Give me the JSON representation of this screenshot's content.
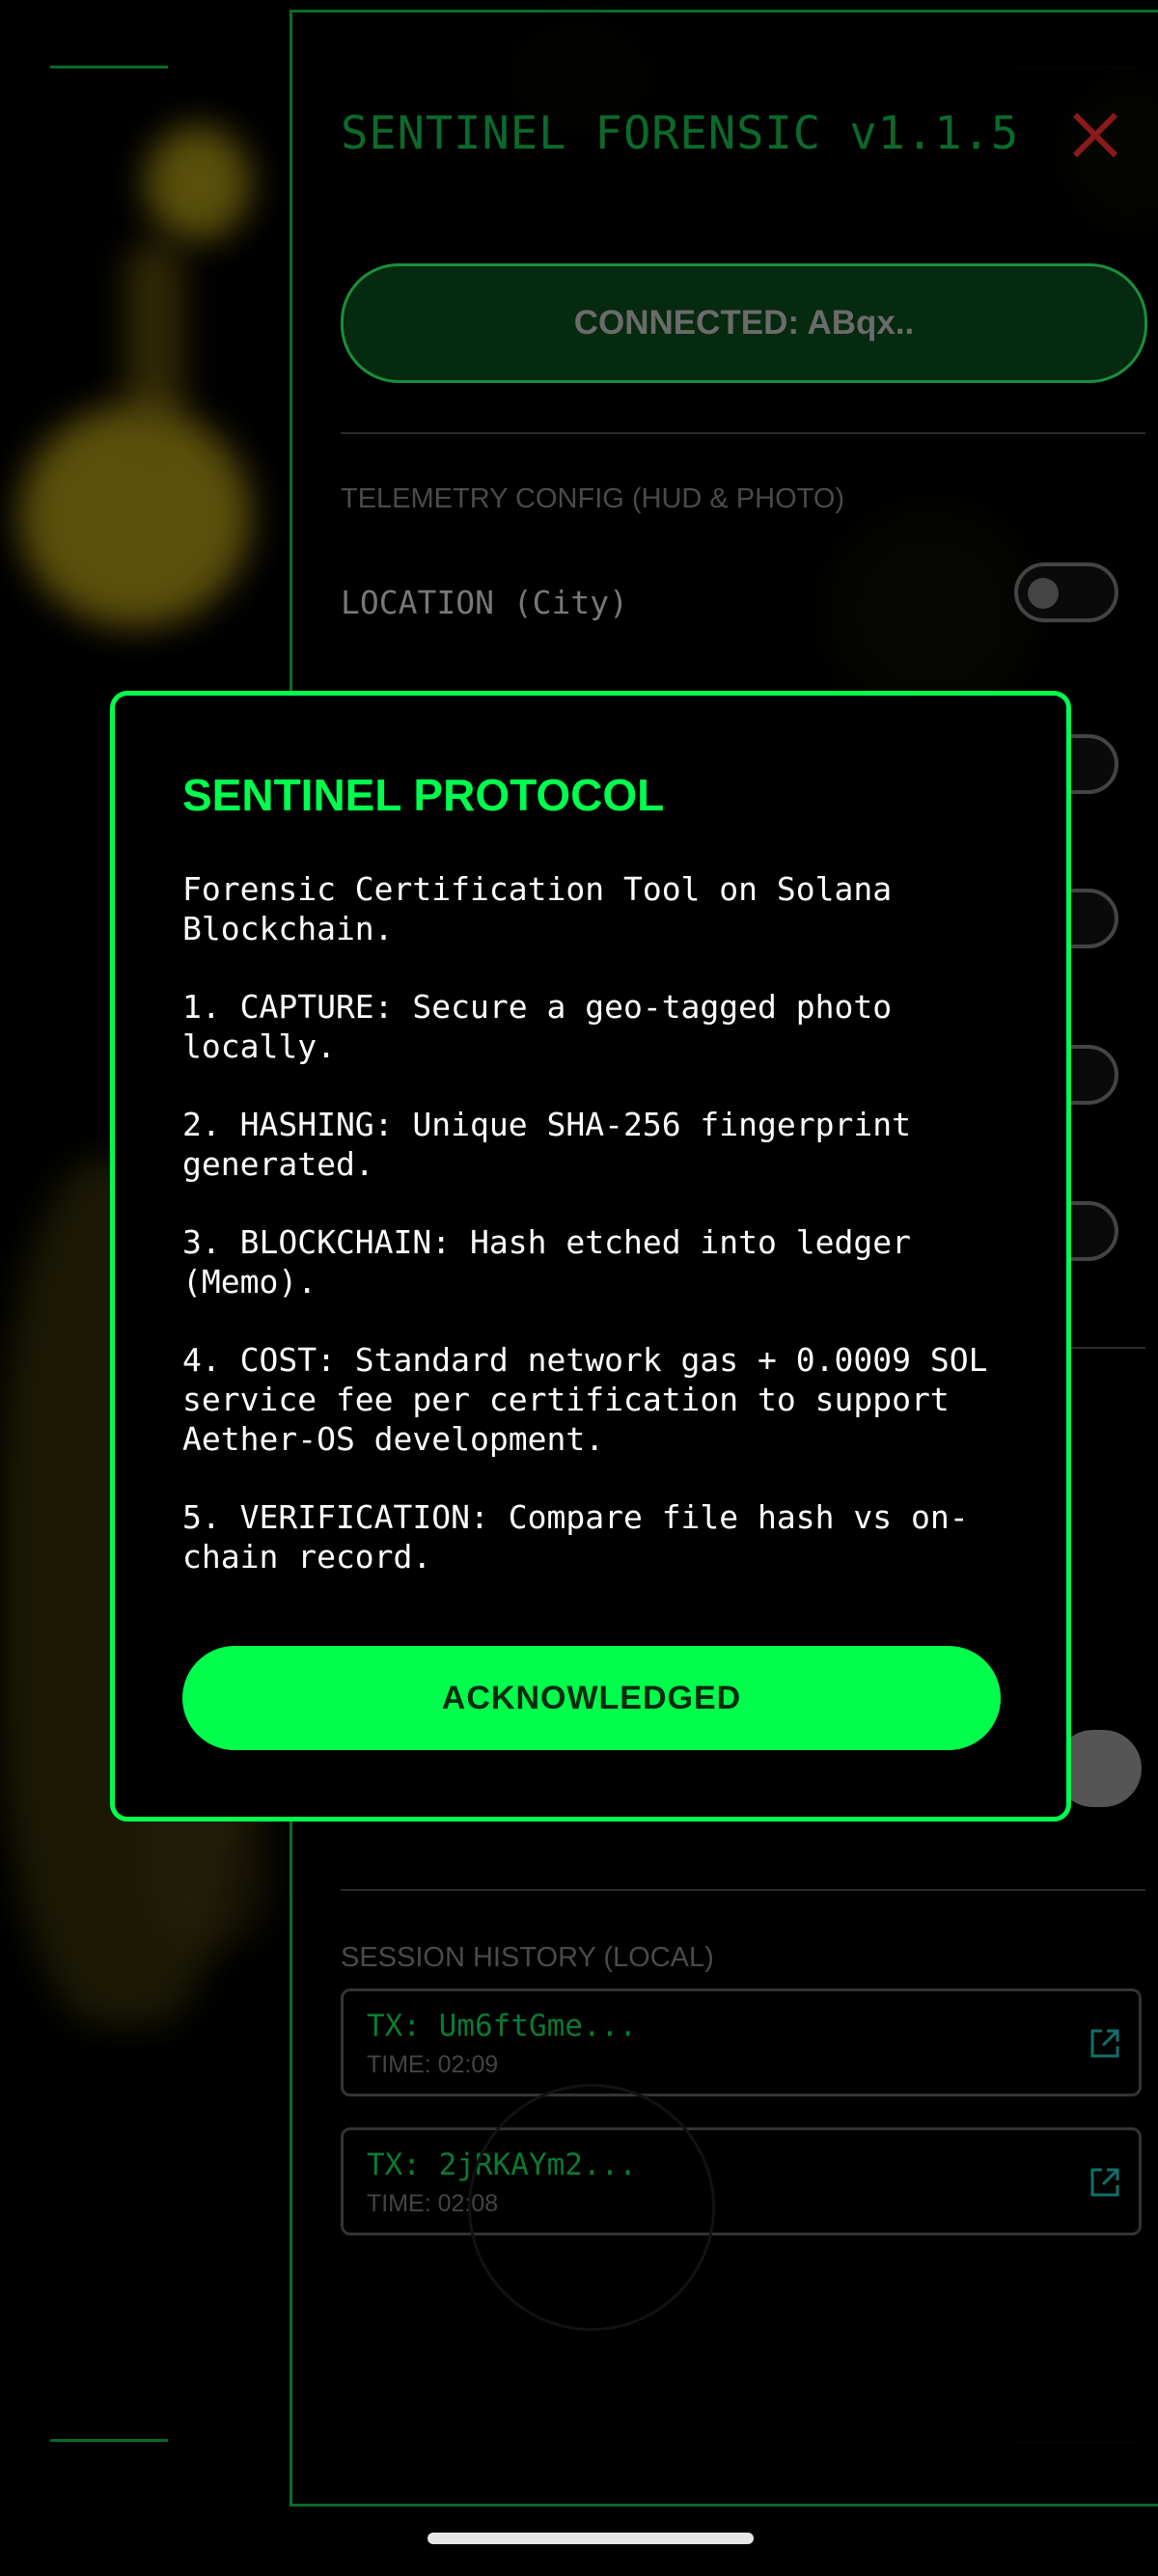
{
  "panel": {
    "title": "SENTINEL FORENSIC v1.1.5",
    "close_icon": "close-icon",
    "connected_label": "CONNECTED: ABqx..",
    "telemetry_section": "TELEMETRY CONFIG (HUD & PHOTO)",
    "toggles": [
      {
        "label": "LOCATION (City)",
        "checked": false
      }
    ],
    "history_section": "SESSION HISTORY (LOCAL)",
    "history": [
      {
        "tx": "TX: Um6ftGme...",
        "time": "TIME: 02:09"
      },
      {
        "tx": "TX: 2jRKAYm2...",
        "time": "TIME: 02:08"
      }
    ]
  },
  "modal": {
    "title": "SENTINEL PROTOCOL",
    "paragraphs": [
      "Forensic Certification Tool on Solana Blockchain.",
      "1. CAPTURE: Secure a geo-tagged photo locally.",
      "2. HASHING: Unique SHA-256 fingerprint generated.",
      "3. BLOCKCHAIN: Hash etched into ledger (Memo).",
      "4. COST: Standard network gas + 0.0009 SOL service fee per certification to support Aether-OS development.",
      "5. VERIFICATION: Compare file hash vs on-chain record."
    ],
    "button_label": "ACKNOWLEDGED"
  },
  "colors": {
    "accent": "#00ff4c",
    "panel_border": "#0c6b28",
    "close": "#8a1a1a"
  }
}
